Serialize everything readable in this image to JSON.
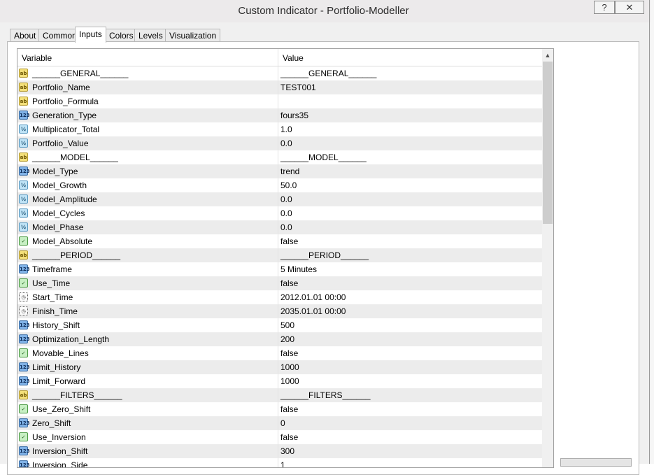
{
  "window": {
    "title": "Custom Indicator - Portfolio-Modeller",
    "help_label": "?",
    "close_label": "✕"
  },
  "tabs": [
    {
      "label": "About",
      "active": false
    },
    {
      "label": "Common",
      "active": false
    },
    {
      "label": "Inputs",
      "active": true
    },
    {
      "label": "Colors",
      "active": false
    },
    {
      "label": "Levels",
      "active": false
    },
    {
      "label": "Visualization",
      "active": false
    }
  ],
  "grid": {
    "columns": {
      "variable": "Variable",
      "value": "Value"
    },
    "rows": [
      {
        "type": "string",
        "icon": "ab",
        "name": "______GENERAL______",
        "value": "______GENERAL______"
      },
      {
        "type": "string",
        "icon": "ab",
        "name": "Portfolio_Name",
        "value": "TEST001"
      },
      {
        "type": "string",
        "icon": "ab",
        "name": "Portfolio_Formula",
        "value": ""
      },
      {
        "type": "int",
        "icon": "123",
        "name": "Generation_Type",
        "value": "fours35"
      },
      {
        "type": "double",
        "icon": "½",
        "name": "Multiplicator_Total",
        "value": "1.0"
      },
      {
        "type": "double",
        "icon": "½",
        "name": "Portfolio_Value",
        "value": "0.0"
      },
      {
        "type": "string",
        "icon": "ab",
        "name": "______MODEL______",
        "value": "______MODEL______"
      },
      {
        "type": "int",
        "icon": "123",
        "name": "Model_Type",
        "value": "trend"
      },
      {
        "type": "double",
        "icon": "½",
        "name": "Model_Growth",
        "value": "50.0"
      },
      {
        "type": "double",
        "icon": "½",
        "name": "Model_Amplitude",
        "value": "0.0"
      },
      {
        "type": "double",
        "icon": "½",
        "name": "Model_Cycles",
        "value": "0.0"
      },
      {
        "type": "double",
        "icon": "½",
        "name": "Model_Phase",
        "value": "0.0"
      },
      {
        "type": "bool",
        "icon": "✓",
        "name": "Model_Absolute",
        "value": "false"
      },
      {
        "type": "string",
        "icon": "ab",
        "name": "______PERIOD______",
        "value": "______PERIOD______"
      },
      {
        "type": "int",
        "icon": "123",
        "name": "Timeframe",
        "value": "5 Minutes"
      },
      {
        "type": "bool",
        "icon": "✓",
        "name": "Use_Time",
        "value": "false"
      },
      {
        "type": "datetime",
        "icon": "◷",
        "name": "Start_Time",
        "value": "2012.01.01 00:00"
      },
      {
        "type": "datetime",
        "icon": "◷",
        "name": "Finish_Time",
        "value": "2035.01.01 00:00"
      },
      {
        "type": "int",
        "icon": "123",
        "name": "History_Shift",
        "value": "500"
      },
      {
        "type": "int",
        "icon": "123",
        "name": "Optimization_Length",
        "value": "200"
      },
      {
        "type": "bool",
        "icon": "✓",
        "name": "Movable_Lines",
        "value": "false"
      },
      {
        "type": "int",
        "icon": "123",
        "name": "Limit_History",
        "value": "1000"
      },
      {
        "type": "int",
        "icon": "123",
        "name": "Limit_Forward",
        "value": "1000"
      },
      {
        "type": "string",
        "icon": "ab",
        "name": "______FILTERS______",
        "value": "______FILTERS______"
      },
      {
        "type": "bool",
        "icon": "✓",
        "name": "Use_Zero_Shift",
        "value": "false"
      },
      {
        "type": "int",
        "icon": "123",
        "name": "Zero_Shift",
        "value": "0"
      },
      {
        "type": "bool",
        "icon": "✓",
        "name": "Use_Inversion",
        "value": "false"
      },
      {
        "type": "int",
        "icon": "123",
        "name": "Inversion_Shift",
        "value": "300"
      },
      {
        "type": "int",
        "icon": "123",
        "name": "Inversion_Side",
        "value": "1"
      }
    ]
  },
  "colors": {
    "row_alt": "#ececec",
    "string_icon": "#f3df79",
    "int_icon": "#7fb1e6",
    "double_icon": "#bfe3f6",
    "bool_icon": "#c7efc3"
  }
}
